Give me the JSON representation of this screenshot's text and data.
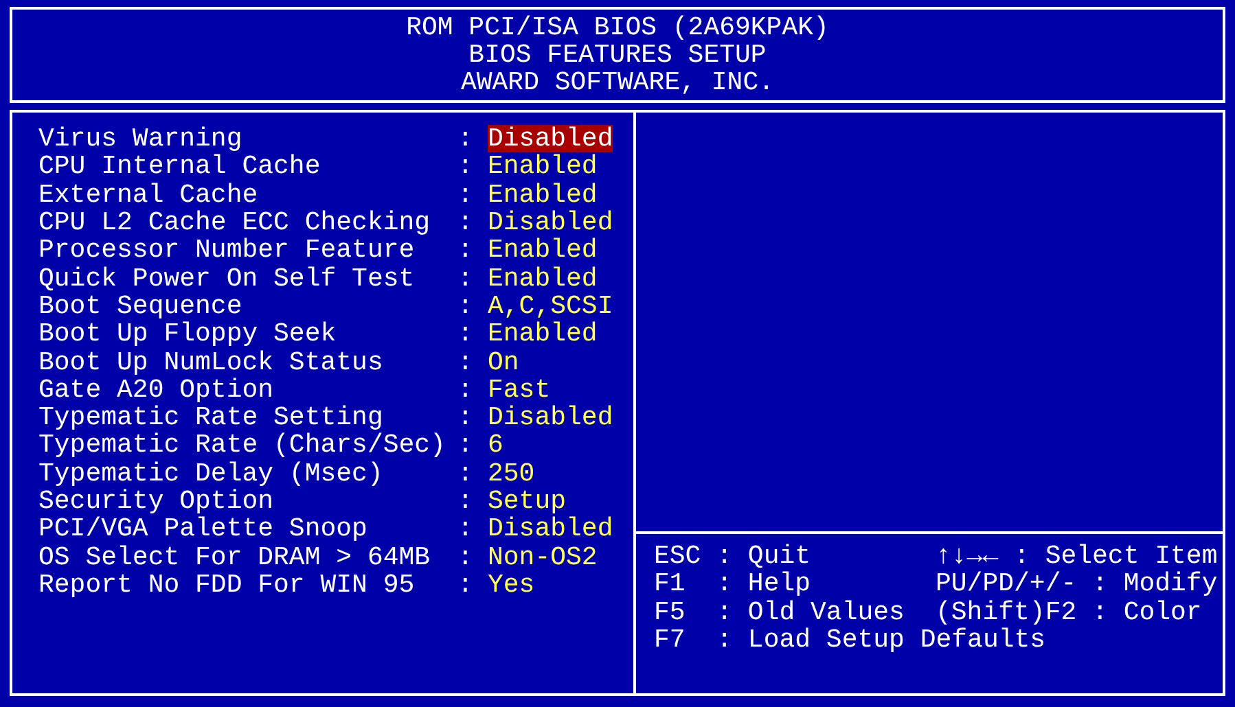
{
  "header": {
    "lines": [
      "ROM PCI/ISA BIOS (2A69KPAK)",
      "BIOS FEATURES SETUP",
      "AWARD SOFTWARE, INC."
    ]
  },
  "settings": [
    {
      "label": "Virus Warning",
      "sep": ":",
      "value": "Disabled",
      "selected": true
    },
    {
      "label": "CPU Internal Cache",
      "sep": ":",
      "value": "Enabled",
      "selected": false
    },
    {
      "label": "External Cache",
      "sep": ":",
      "value": "Enabled",
      "selected": false
    },
    {
      "label": "CPU L2 Cache ECC Checking",
      "sep": ":",
      "value": "Disabled",
      "selected": false
    },
    {
      "label": "Processor Number Feature",
      "sep": ":",
      "value": "Enabled",
      "selected": false
    },
    {
      "label": "Quick Power On Self Test",
      "sep": ":",
      "value": "Enabled",
      "selected": false
    },
    {
      "label": "Boot Sequence",
      "sep": ":",
      "value": "A,C,SCSI",
      "selected": false
    },
    {
      "label": "Boot Up Floppy Seek",
      "sep": ":",
      "value": "Enabled",
      "selected": false
    },
    {
      "label": "Boot Up NumLock Status",
      "sep": ":",
      "value": "On",
      "selected": false
    },
    {
      "label": "Gate A20 Option",
      "sep": ":",
      "value": "Fast",
      "selected": false
    },
    {
      "label": "Typematic Rate Setting",
      "sep": ":",
      "value": "Disabled",
      "selected": false
    },
    {
      "label": "Typematic Rate (Chars/Sec)",
      "sep": ":",
      "value": "6",
      "selected": false
    },
    {
      "label": "Typematic Delay (Msec)",
      "sep": ":",
      "value": "250",
      "selected": false
    },
    {
      "label": "Security Option",
      "sep": ":",
      "value": "Setup",
      "selected": false
    },
    {
      "label": "PCI/VGA Palette Snoop",
      "sep": ":",
      "value": "Disabled",
      "selected": false
    },
    {
      "label": "OS Select For DRAM > 64MB",
      "sep": ":",
      "value": "Non-OS2",
      "selected": false
    },
    {
      "label": "Report No FDD For WIN 95",
      "sep": ":",
      "value": "Yes",
      "selected": false
    }
  ],
  "help": [
    {
      "left": "ESC : Quit",
      "right": "↑↓→← : Select Item"
    },
    {
      "left": "F1  : Help",
      "right": "PU/PD/+/- : Modify"
    },
    {
      "left": "F5  : Old Values",
      "right": "(Shift)F2 : Color"
    },
    {
      "left": "F7  : Load Setup Defaults"
    }
  ]
}
